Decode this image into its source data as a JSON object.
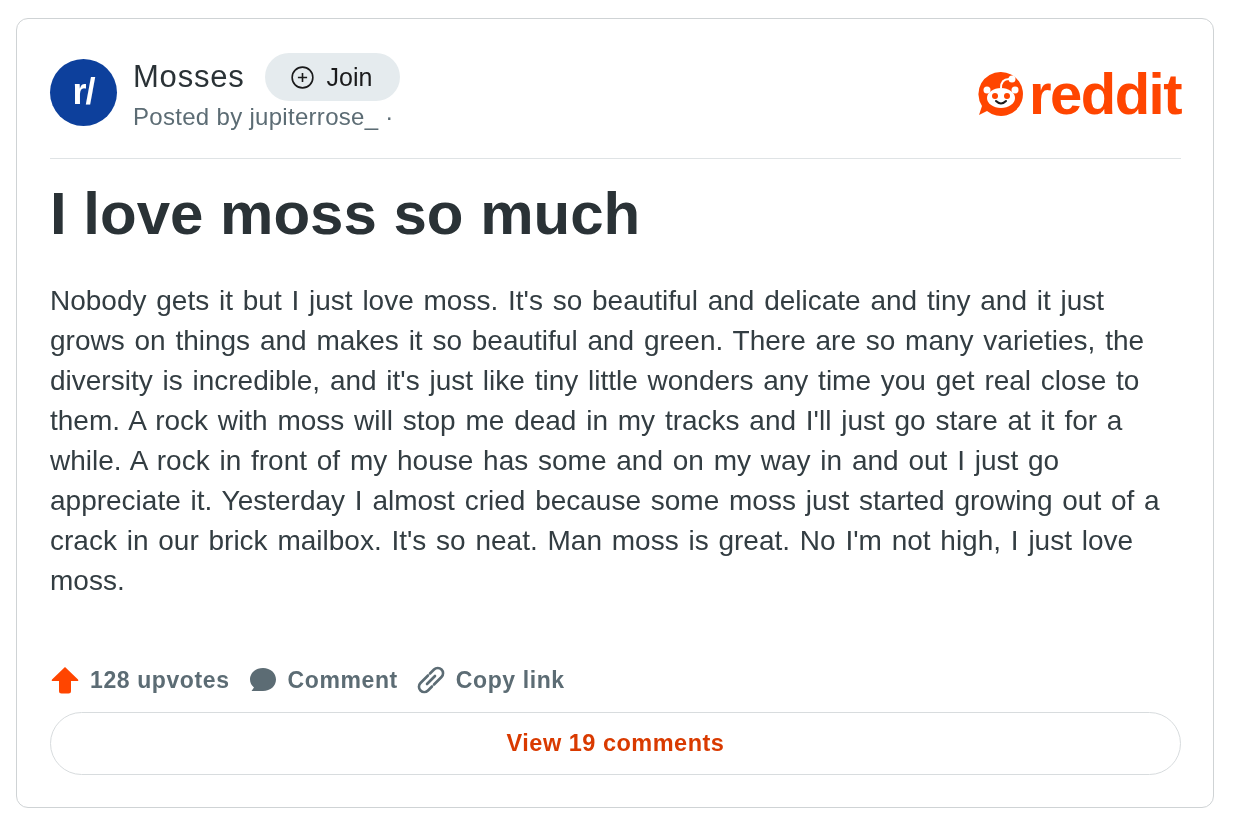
{
  "post": {
    "community": {
      "avatar_text": "r/",
      "name": "Mosses",
      "join_label": "Join"
    },
    "byline": "Posted by jupiterrose_ ·",
    "logo_text": "reddit",
    "title": "I love moss so much",
    "body": "Nobody gets it but I just love moss. It's so beautiful and delicate and tiny and it just grows on things and makes it so beautiful and green. There are so many varieties, the diversity is incredible, and it's just like tiny little wonders any time you get real close to them. A rock with moss will stop me dead in my tracks and I'll just go stare at it for a while. A rock in front of my house has some and on my way in and out I just go appreciate it. Yesterday I almost cried because some moss just started growing out of a crack in our brick mailbox. It's so neat. Man moss is great. No I'm not high, I just love moss.",
    "actions": [
      {
        "kind": "upvote",
        "label": "128 upvotes"
      },
      {
        "kind": "comment",
        "label": "Comment"
      },
      {
        "kind": "copy_link",
        "label": "Copy link"
      }
    ],
    "view_comments": "View 19 comments"
  }
}
